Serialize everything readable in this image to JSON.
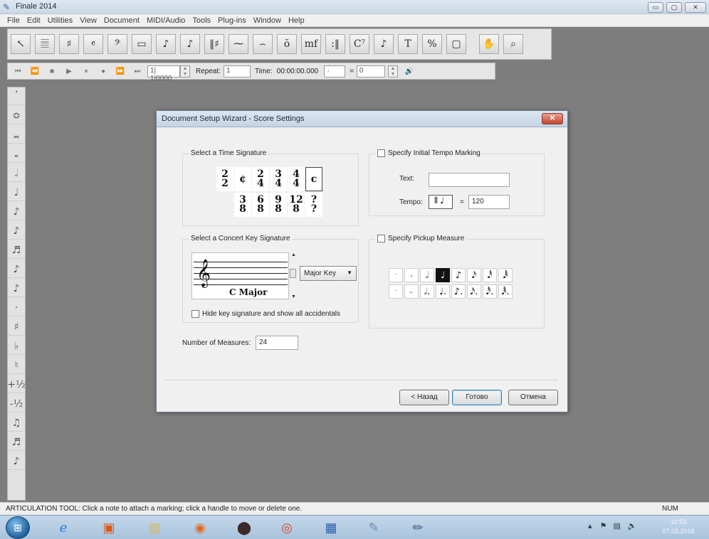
{
  "window": {
    "title": "Finale 2014"
  },
  "menu": [
    "File",
    "Edit",
    "Utilities",
    "View",
    "Document",
    "MIDI/Audio",
    "Tools",
    "Plug-ins",
    "Window",
    "Help"
  ],
  "main_tools": [
    {
      "icon": "selection-tool-icon",
      "glyph": "↖"
    },
    {
      "icon": "staff-tool-icon",
      "glyph": "𝄚"
    },
    {
      "icon": "key-signature-tool-icon",
      "glyph": "♯"
    },
    {
      "icon": "time-signature-tool-icon",
      "glyph": "𝄴"
    },
    {
      "icon": "clef-tool-icon",
      "glyph": "𝄢"
    },
    {
      "icon": "measure-tool-icon",
      "glyph": "▭"
    },
    {
      "icon": "simple-entry-tool-icon",
      "glyph": "♪"
    },
    {
      "icon": "speedy-entry-tool-icon",
      "glyph": "♪"
    },
    {
      "icon": "tuplet-tool-icon",
      "glyph": "‖♯"
    },
    {
      "icon": "smart-shape-tool-icon",
      "glyph": "⁓"
    },
    {
      "icon": "articulation-tool-icon",
      "glyph": "⌢"
    },
    {
      "icon": "expression-tool-icon",
      "glyph": "ŏ"
    },
    {
      "icon": "dynamics-tool-icon",
      "glyph": "mf"
    },
    {
      "icon": "repeat-tool-icon",
      "glyph": ":‖"
    },
    {
      "icon": "chord-tool-icon",
      "glyph": "C⁷"
    },
    {
      "icon": "lyrics-tool-icon",
      "glyph": "♪"
    },
    {
      "icon": "text-tool-icon",
      "glyph": "T"
    },
    {
      "icon": "resize-tool-icon",
      "glyph": "%"
    },
    {
      "icon": "page-layout-tool-icon",
      "glyph": "▢"
    },
    {
      "icon": "hand-grabber-tool-icon",
      "glyph": "✋"
    },
    {
      "icon": "zoom-tool-icon",
      "glyph": "⌕"
    }
  ],
  "playback": {
    "counter": "1| 1|0000",
    "repeat_label": "Repeat:",
    "repeat_value": "1",
    "time_label": "Time:",
    "time_value": "00:00:00.000",
    "equals": "=",
    "tempo_value": "0"
  },
  "left_tools": [
    "𝄒",
    "≎",
    "𝅜",
    "𝅝",
    "𝅗𝅥",
    "♩",
    "♪",
    "♪",
    "♬",
    "♪",
    "♪",
    "·",
    "♯",
    "♭",
    "♮",
    "+½",
    "-½",
    "♫",
    "♬",
    "♪"
  ],
  "dialog": {
    "title": "Document Setup Wizard - Score Settings",
    "close": "✕",
    "time_sig_group": "Select a Time Signature",
    "time_signatures": [
      {
        "top": "2",
        "bottom": "2"
      },
      {
        "top": "¢",
        "bottom": ""
      },
      {
        "top": "2",
        "bottom": "4"
      },
      {
        "top": "3",
        "bottom": "4"
      },
      {
        "top": "4",
        "bottom": "4"
      },
      {
        "top": "c",
        "bottom": "",
        "selected": true
      },
      {
        "top": "3",
        "bottom": "8"
      },
      {
        "top": "6",
        "bottom": "8"
      },
      {
        "top": "9",
        "bottom": "8"
      },
      {
        "top": "12",
        "bottom": "8"
      },
      {
        "top": "?",
        "bottom": "?"
      }
    ],
    "tempo_group": "Specify Initial Tempo Marking",
    "text_label": "Text:",
    "text_value": "",
    "tempo_label": "Tempo:",
    "tempo_note": "♩",
    "tempo_equals": "=",
    "tempo_value": "120",
    "key_group": "Select a Concert Key Signature",
    "key_name": "C Major",
    "key_mode": "Major Key",
    "hide_key_label": "Hide key signature and show all accidentals",
    "pickup_group": "Specify Pickup Measure",
    "pickup_row1": [
      "𝄻",
      "𝅝",
      "𝅗𝅥",
      "♩",
      "♪",
      "𝅘𝅥𝅯",
      "𝅘𝅥𝅰",
      "𝅘𝅥𝅱"
    ],
    "pickup_row2": [
      "𝄻",
      "𝅝.",
      "𝅗𝅥.",
      "♩.",
      "♪.",
      "𝅘𝅥𝅯.",
      "𝅘𝅥𝅰.",
      "𝅘𝅥𝅱."
    ],
    "measures_label": "Number of Measures:",
    "measures_value": "24",
    "back": "< Назад",
    "finish": "Готово",
    "cancel": "Отмена"
  },
  "status": {
    "text": "ARTICULATION TOOL: Click a note to attach a marking; click a handle to move or delete one.",
    "num": "NUM"
  },
  "taskbar": {
    "time": "10:53",
    "date": "07.03.2016"
  }
}
